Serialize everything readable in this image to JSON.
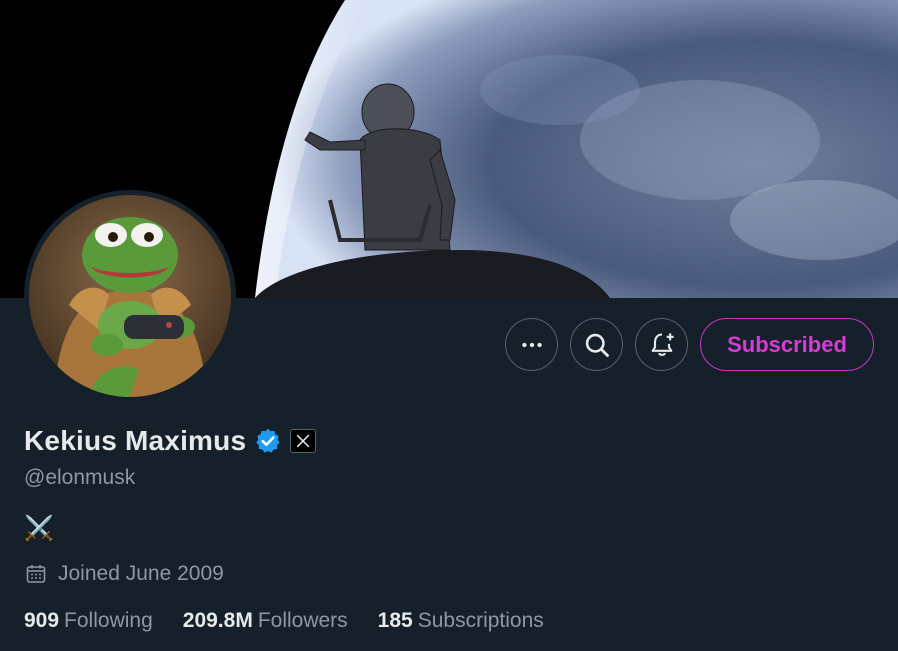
{
  "profile": {
    "name": "Kekius Maximus",
    "handle": "@elonmusk",
    "bio": "⚔️",
    "joined": "Joined June 2009"
  },
  "actions": {
    "more_icon": "more-horizontal-icon",
    "search_icon": "search-icon",
    "notify_icon": "bell-add-icon",
    "subscribed_label": "Subscribed"
  },
  "stats": {
    "following_count": "909",
    "following_label": "Following",
    "followers_count": "209.8M",
    "followers_label": "Followers",
    "subscriptions_count": "185",
    "subscriptions_label": "Subscriptions"
  },
  "colors": {
    "background": "#15202b",
    "subscribed_accent": "#d63dd6",
    "verified": "#1d9bf0",
    "muted_text": "#8b98a5"
  }
}
